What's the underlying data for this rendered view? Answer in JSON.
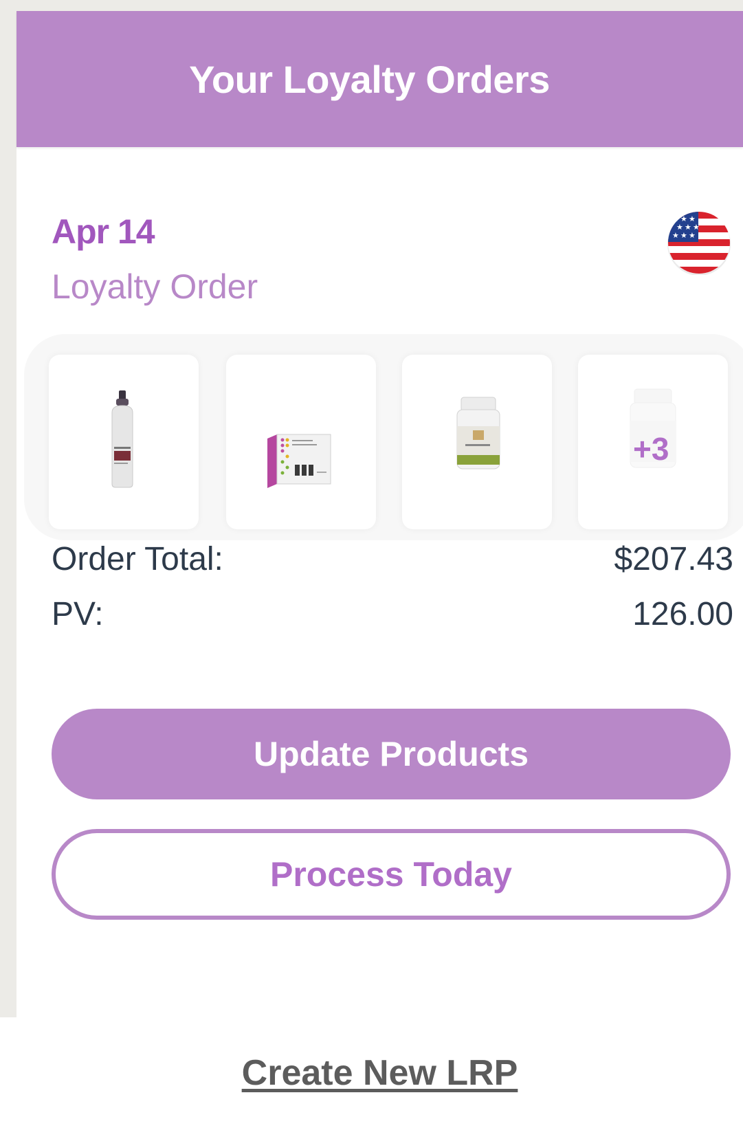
{
  "header": {
    "title": "Your Loyalty Orders"
  },
  "order": {
    "date": "Apr 14",
    "type": "Loyalty Order",
    "country_flag_icon": "us-flag-icon",
    "products": [
      {
        "icon": "shampoo-bottle-icon"
      },
      {
        "icon": "vitality-pack-box-icon"
      },
      {
        "icon": "supplement-bottle-icon"
      },
      {
        "icon": "supplement-bottle-icon",
        "more_count": "+3"
      }
    ],
    "total_label": "Order Total:",
    "total_value": "$207.43",
    "pv_label": "PV:",
    "pv_value": "126.00"
  },
  "actions": {
    "update_label": "Update Products",
    "process_label": "Process Today",
    "create_link": "Create New LRP"
  },
  "colors": {
    "accent": "#b888c8",
    "accent_text": "#a157bd",
    "text": "#2d3a4a",
    "page_bg": "#ecebe7"
  }
}
